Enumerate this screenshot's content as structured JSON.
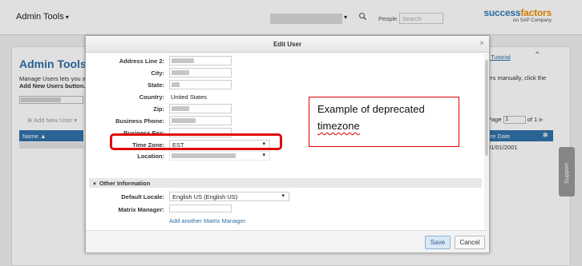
{
  "topbar": {
    "app_title": "Admin Tools",
    "people_label": "People",
    "search_placeholder": "Search",
    "brand_main_a": "success",
    "brand_main_b": "factors",
    "brand_sub": "An SAP Company"
  },
  "background": {
    "title": "Admin Tools",
    "desc_line1": "Manage Users lets you a",
    "desc_line2": "Add New Users button.T",
    "add_new_user": "Add New User",
    "name_col": "Name",
    "tutorial_link": "e Tutorial",
    "right_text": "ers manually, click the",
    "page_label": "Page",
    "page_value": "1",
    "page_of": "of 1",
    "date_col": "ire Date",
    "date_value": "01/01/2001",
    "support": "Support"
  },
  "dialog": {
    "title": "Edit User",
    "fields": {
      "address2": "Address Line 2:",
      "city": "City:",
      "state": "State:",
      "country": "Country:",
      "country_value": "United States",
      "zip": "Zip:",
      "business_phone": "Business Phone:",
      "business_fax": "Business Fax:",
      "time_zone": "Time Zone:",
      "time_zone_value": "EST",
      "location": "Location:"
    },
    "section_other": "Other Information",
    "default_locale": "Default Locale:",
    "default_locale_value": "English US (English US)",
    "matrix_manager": "Matrix Manager:",
    "add_matrix_manager": "Add another Matrix Manager",
    "save": "Save",
    "cancel": "Cancel"
  },
  "annotation": {
    "line1": "Example of deprecated",
    "line2": "timezone",
    "highlight_color": "#e10a0a"
  }
}
